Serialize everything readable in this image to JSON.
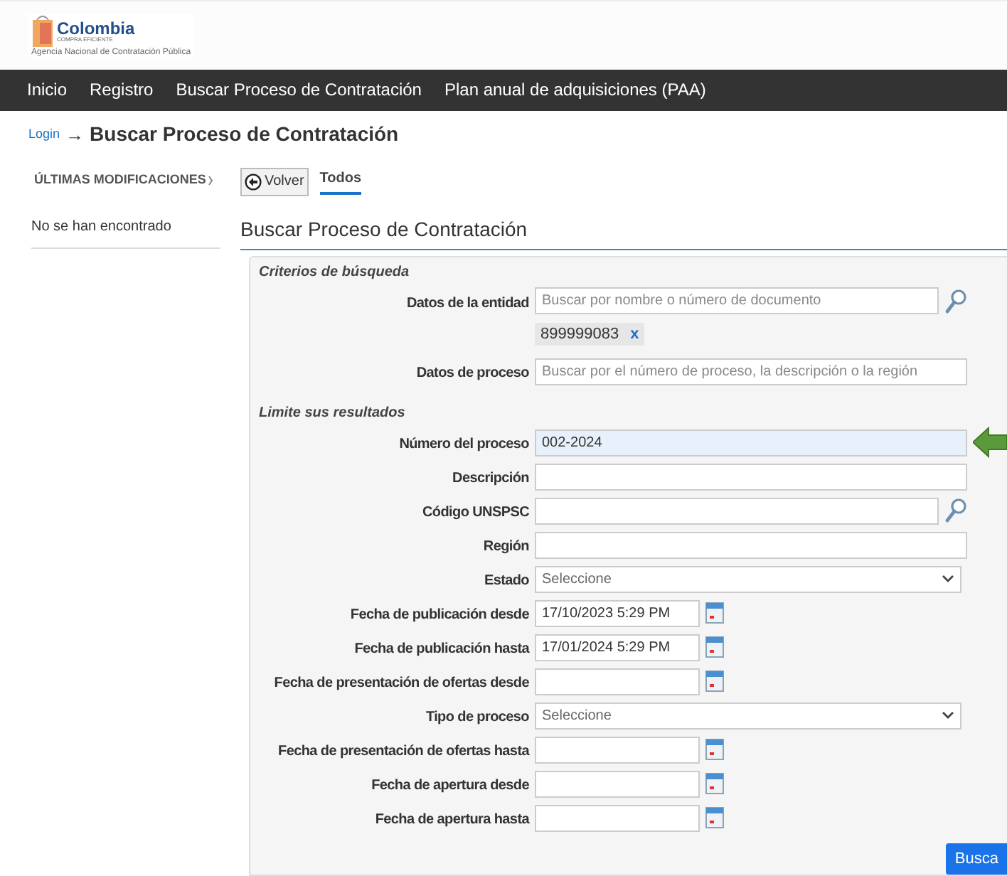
{
  "logo": {
    "name": "Colombia",
    "tagline": "COMPRA EFICIENTE",
    "agency": "Agencia Nacional de Contratación Pública"
  },
  "nav": [
    "Inicio",
    "Registro",
    "Buscar Proceso de Contratación",
    "Plan anual de adquisiciones (PAA)"
  ],
  "breadcrumb": {
    "link": "Login",
    "separator": "→",
    "current": "Buscar Proceso de Contratación"
  },
  "sidebar": {
    "title": "ÚLTIMAS MODIFICACIONES",
    "empty_text": "No se han encontrado"
  },
  "back_button": "Volver",
  "tabs": [
    {
      "label": "Todos",
      "selected": true
    }
  ],
  "form_title": "Buscar Proceso de Contratación",
  "sections": [
    {
      "title": "Criterios de búsqueda",
      "fields": [
        {
          "kind": "search",
          "label": "Datos de la entidad",
          "placeholder": "Buscar por nombre o número de documento",
          "tags": [
            {
              "text": "899999083",
              "remove": "x"
            }
          ]
        },
        {
          "kind": "text",
          "label": "Datos de proceso",
          "placeholder": "Buscar por el número de proceso, la descripción o la región"
        }
      ]
    },
    {
      "title": "Limite sus resultados",
      "fields": [
        {
          "kind": "text",
          "label": "Número del proceso",
          "value": "002-2024",
          "highlighted": true
        },
        {
          "kind": "text",
          "label": "Descripción"
        },
        {
          "kind": "search",
          "label": "Código UNSPSC"
        },
        {
          "kind": "text",
          "label": "Región"
        },
        {
          "kind": "select",
          "label": "Estado",
          "value": "Seleccione"
        },
        {
          "kind": "date",
          "label": "Fecha de publicación desde",
          "value": "17/10/2023 5:29 PM"
        },
        {
          "kind": "date",
          "label": "Fecha de publicación hasta",
          "value": "17/01/2024 5:29 PM"
        },
        {
          "kind": "date",
          "label": "Fecha de presentación de ofertas desde"
        },
        {
          "kind": "select",
          "label": "Tipo de proceso",
          "value": "Seleccione"
        },
        {
          "kind": "date",
          "label": "Fecha de presentación de ofertas hasta"
        },
        {
          "kind": "date",
          "label": "Fecha de apertura desde"
        },
        {
          "kind": "date",
          "label": "Fecha de apertura hasta"
        }
      ]
    }
  ],
  "search_button": "Busca"
}
